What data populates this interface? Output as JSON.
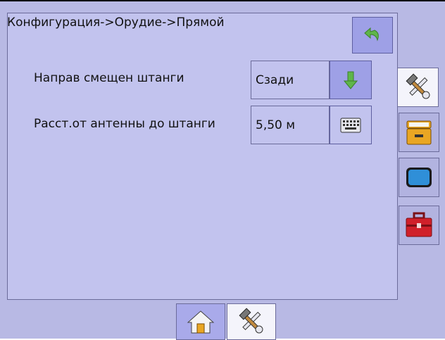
{
  "header": {
    "breadcrumb": "Конфигурация->Орудие->Прямой"
  },
  "toolbar": {
    "back_icon": "back-arrow-icon"
  },
  "settings": [
    {
      "label": "Направ смещен штанги",
      "value": "Сзади",
      "control_icon": "arrow-down-icon"
    },
    {
      "label": "Расст.от антенны до штанги",
      "value": "5,50 м",
      "control_icon": "keyboard-icon"
    }
  ],
  "side_tabs": [
    {
      "icon": "tools-icon",
      "active": true
    },
    {
      "icon": "storage-icon",
      "active": false
    },
    {
      "icon": "display-icon",
      "active": false
    },
    {
      "icon": "toolbox-icon",
      "active": false
    }
  ],
  "bottom_tabs": [
    {
      "icon": "home-icon",
      "active": false
    },
    {
      "icon": "tools-icon",
      "active": true
    }
  ],
  "colors": {
    "background": "#b8b9e4",
    "panel": "#c2c3ee",
    "button": "#9ea0e6",
    "accent_green": "#5fb64a",
    "toolbox_red": "#d0202a",
    "storage_orange": "#e9a623",
    "display_blue": "#2f8fd8"
  }
}
